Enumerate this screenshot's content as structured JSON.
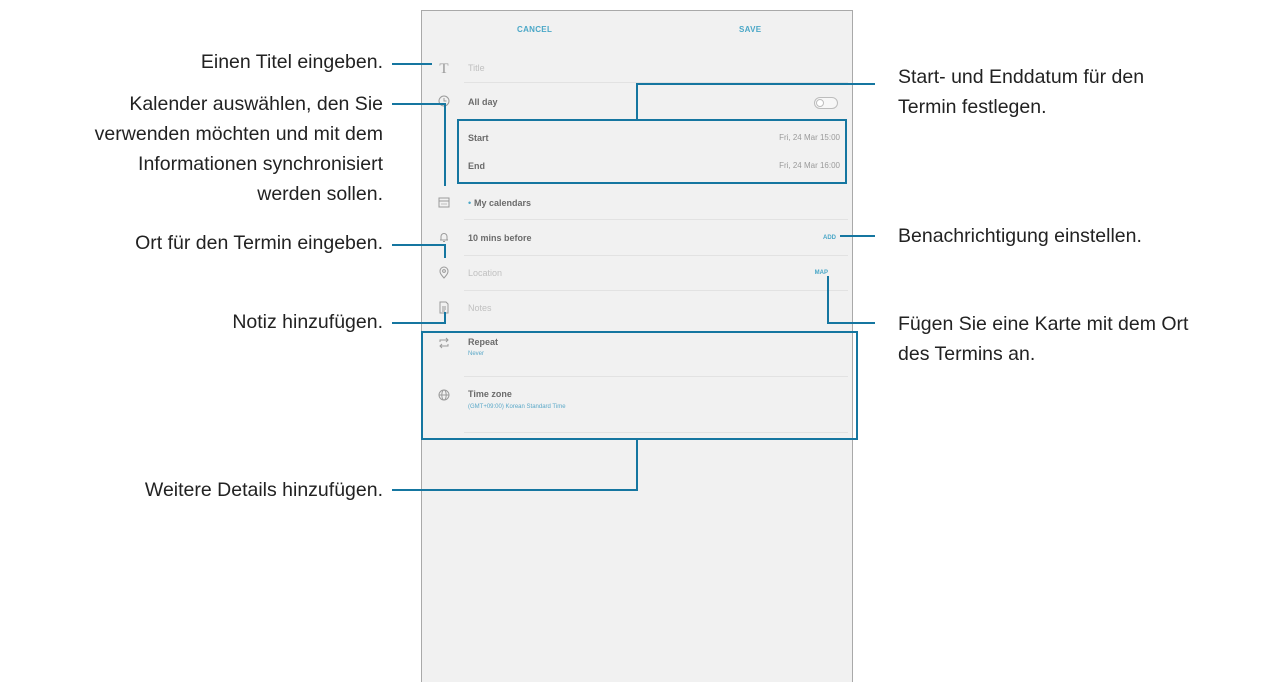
{
  "screen": {
    "cancel_label": "CANCEL",
    "save_label": "SAVE",
    "title_placeholder": "Title",
    "all_day_label": "All day",
    "start_label": "Start",
    "start_value": "Fri, 24 Mar   15:00",
    "end_label": "End",
    "end_value": "Fri, 24 Mar   16:00",
    "calendar_label": "My calendars",
    "reminder_label": "10 mins before",
    "reminder_add": "ADD",
    "location_placeholder": "Location",
    "location_map": "MAP",
    "notes_placeholder": "Notes",
    "repeat_label": "Repeat",
    "repeat_value": "Never",
    "timezone_label": "Time zone",
    "timezone_value": "(GMT+09:00) Korean Standard Time"
  },
  "callouts": {
    "title": "Einen Titel eingeben.",
    "calendar_1": "Kalender auswählen, den Sie",
    "calendar_2": "verwenden möchten und mit dem",
    "calendar_3": "Informationen synchronisiert",
    "calendar_4": "werden sollen.",
    "location": "Ort für den Termin eingeben.",
    "notes": "Notiz hinzufügen.",
    "more": "Weitere Details hinzufügen.",
    "date_1": "Start- und Enddatum für den",
    "date_2": "Termin festlegen.",
    "alert": "Benachrichtigung einstellen.",
    "map_1": "Fügen Sie eine Karte mit dem Ort",
    "map_2": "des Termins an."
  },
  "colors": {
    "leader_line": "#1576a0",
    "accent": "#4aa7c7",
    "screen_background": "#f1f1f1"
  },
  "icons": [
    "title-icon",
    "clock-icon",
    "calendar-icon",
    "bell-icon",
    "location-pin-icon",
    "notes-icon",
    "repeat-icon",
    "globe-icon"
  ]
}
